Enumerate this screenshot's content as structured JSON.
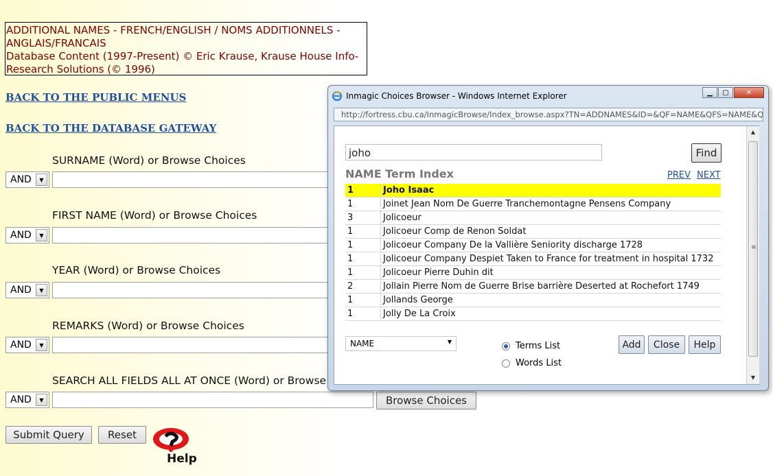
{
  "header": {
    "line1": "ADDITIONAL NAMES - FRENCH/ENGLISH / NOMS ADDITIONNELS - ANGLAIS/FRANCAIS",
    "line2": "Database Content (1997-Present) © Eric Krause, Krause House Info-Research Solutions (© 1996)"
  },
  "links": {
    "public_menus": "BACK TO THE PUBLIC MENUS",
    "gateway": "BACK TO THE DATABASE GATEWAY"
  },
  "fields": [
    {
      "label": "SURNAME (Word) or Browse Choices",
      "operator": "AND"
    },
    {
      "label": "FIRST NAME (Word) or Browse Choices",
      "operator": "AND"
    },
    {
      "label": "YEAR (Word) or Browse Choices",
      "operator": "AND"
    },
    {
      "label": "REMARKS (Word) or Browse Choices",
      "operator": "AND"
    },
    {
      "label": "SEARCH ALL FIELDS ALL AT ONCE (Word) or Browse",
      "operator": "AND"
    }
  ],
  "browse_button": "Browse Choices",
  "form_buttons": {
    "submit": "Submit Query",
    "reset": "Reset"
  },
  "help_logo_text": "Help",
  "popup": {
    "title": "Inmagic Choices Browser - Windows Internet Explorer",
    "url": "http://fortress.cbu.ca/InmagicBrowse/Index_browse.aspx?TN=ADDNAMES&ID=&QF=NAME&QFS=NAME&Q",
    "search_value": "joho",
    "find_button": "Find",
    "index_title": "NAME Term Index",
    "prev": "PREV",
    "next": "NEXT",
    "terms": [
      {
        "count": "1",
        "term": "Joho Isaac",
        "highlighted": true
      },
      {
        "count": "1",
        "term": "Joinet Jean Nom De Guerre Tranchemontagne Pensens Company"
      },
      {
        "count": "3",
        "term": "Jolicoeur"
      },
      {
        "count": "1",
        "term": "Jolicoeur Comp de Renon Soldat"
      },
      {
        "count": "1",
        "term": "Jolicoeur Company De la Vallière Seniority discharge 1728"
      },
      {
        "count": "1",
        "term": "Jolicoeur Company Despiet Taken to France for treatment in hospital 1732"
      },
      {
        "count": "1",
        "term": "Jolicoeur Pierre Duhin dit"
      },
      {
        "count": "2",
        "term": "Jollain Pierre Nom de Guerre Brise barrière Deserted at Rochefort 1749"
      },
      {
        "count": "1",
        "term": "Jollands George"
      },
      {
        "count": "1",
        "term": "Jolly De La Croix"
      }
    ],
    "field_select": "NAME",
    "radio_terms": "Terms List",
    "radio_words": "Words List",
    "buttons": {
      "add": "Add",
      "close": "Close",
      "help": "Help"
    }
  },
  "colors": {
    "header_text": "#800000",
    "link": "#1f4fa0",
    "highlight": "#ffff00"
  }
}
